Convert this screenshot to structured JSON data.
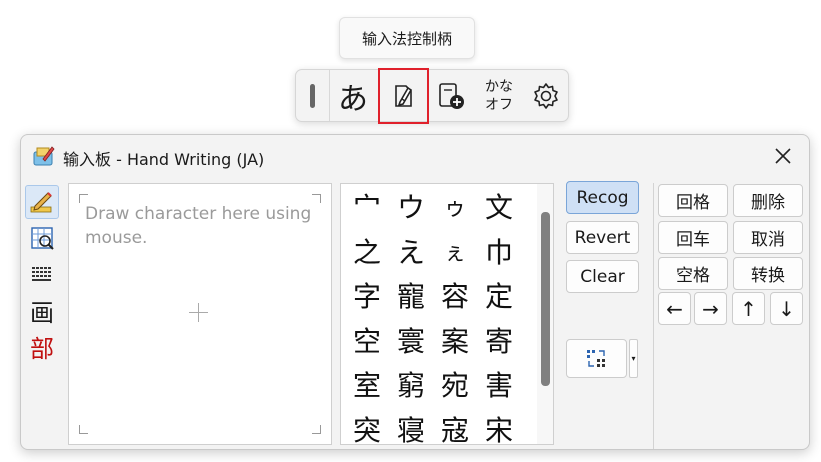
{
  "tooltip": {
    "text": "输入法控制柄"
  },
  "ime_toolbar": {
    "kana_label": "あ",
    "ime_pad_icon": "pen-pad-icon",
    "dict_icon": "dictionary-add-icon",
    "kana_off_line1": "かな",
    "kana_off_line2": "オフ",
    "settings_icon": "gear-icon"
  },
  "window": {
    "title": "输入板 - Hand Writing (JA)",
    "close_icon": "close-icon"
  },
  "tools": [
    {
      "name": "handwriting",
      "icon": "pencil-icon",
      "active": true
    },
    {
      "name": "character-list",
      "icon": "character-list-icon",
      "active": false
    },
    {
      "name": "soft-keyboard",
      "icon": "keyboard-icon",
      "active": false
    },
    {
      "name": "stroke-count",
      "label": "画",
      "active": false
    },
    {
      "name": "radical",
      "label_main": "部",
      "active": false
    }
  ],
  "draw_pad": {
    "hint": "Draw character here using mouse."
  },
  "candidates": [
    "宀",
    "ウ",
    "ゥ",
    "文",
    "之",
    "え",
    "ぇ",
    "巾",
    "字",
    "寵",
    "容",
    "定",
    "空",
    "寰",
    "案",
    "寄",
    "室",
    "窮",
    "宛",
    "害",
    "突",
    "寝",
    "寇",
    "宋"
  ],
  "buttons": {
    "recog": "Recog",
    "revert": "Revert",
    "clear": "Clear",
    "recog_mode_icon": "recognition-mode-icon",
    "dropdown_icon": "dropdown-arrow-icon"
  },
  "edit_keys": {
    "backspace": "回格",
    "delete": "删除",
    "enter": "回车",
    "cancel": "取消",
    "space": "空格",
    "convert": "转换",
    "left": "←",
    "right": "→",
    "up": "↑",
    "down": "↓"
  },
  "colors": {
    "highlight_border": "#e0202b",
    "primary_button": "#cfe0f5",
    "scroll_thumb": "#808080"
  }
}
